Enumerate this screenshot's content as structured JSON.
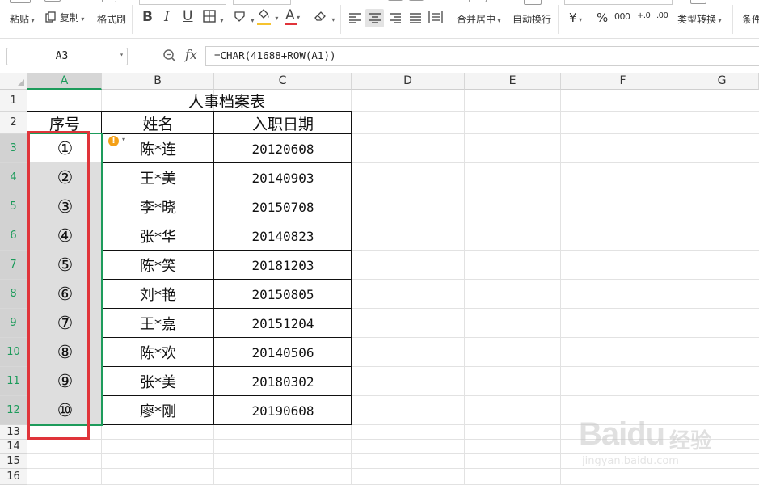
{
  "ribbon": {
    "paste_label": "粘贴",
    "copy_label": "复制",
    "format_painter_label": "格式刷",
    "bold_label": "B",
    "italic_label": "I",
    "underline_label": "U",
    "font_color_label": "A",
    "merge_center_label": "合并居中",
    "wrap_text_label": "自动换行",
    "currency_label": "¥",
    "percent_label": "%",
    "thousands_label": "000",
    "decimal_increase_label": "+.0",
    "decimal_decrease_label": ".00",
    "type_convert_label": "类型转换",
    "conditional_label": "条件",
    "font_color_hex": "#e0343a",
    "fill_color_hex": "#f6c32f"
  },
  "formula_bar": {
    "name_box": "A3",
    "fx_label": "fx",
    "formula": "=CHAR(41688+ROW(A1))"
  },
  "sheet": {
    "columns": [
      "A",
      "B",
      "C",
      "D",
      "E",
      "F",
      "G"
    ],
    "rows": [
      "1",
      "2",
      "3",
      "4",
      "5",
      "6",
      "7",
      "8",
      "9",
      "10",
      "11",
      "12",
      "13",
      "14",
      "15",
      "16"
    ],
    "title": "人事档案表",
    "headers": [
      "序号",
      "姓名",
      "入职日期"
    ],
    "records": [
      {
        "num": "①",
        "name": "陈*连",
        "date": "20120608"
      },
      {
        "num": "②",
        "name": "王*美",
        "date": "20140903"
      },
      {
        "num": "③",
        "name": "李*晓",
        "date": "20150708"
      },
      {
        "num": "④",
        "name": "张*华",
        "date": "20140823"
      },
      {
        "num": "⑤",
        "name": "陈*笑",
        "date": "20181203"
      },
      {
        "num": "⑥",
        "name": "刘*艳",
        "date": "20150805"
      },
      {
        "num": "⑦",
        "name": "王*嘉",
        "date": "20151204"
      },
      {
        "num": "⑧",
        "name": "陈*欢",
        "date": "20140506"
      },
      {
        "num": "⑨",
        "name": "张*美",
        "date": "20180302"
      },
      {
        "num": "⑩",
        "name": "廖*刚",
        "date": "20190608"
      }
    ],
    "selection_color": "#1d9b5b",
    "highlight_color": "#e0343a"
  },
  "watermark": {
    "brand": "Baidu",
    "brand_cn": "经验",
    "url": "jingyan.baidu.com"
  }
}
